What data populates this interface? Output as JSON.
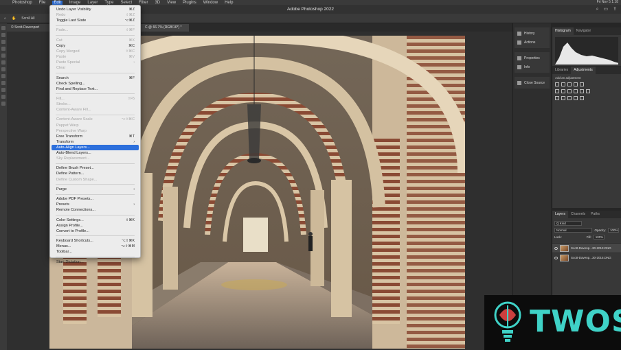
{
  "menubar": {
    "app": "Photoshop",
    "items": [
      "File",
      "Edit",
      "Image",
      "Layer",
      "Type",
      "Select",
      "Filter",
      "3D",
      "View",
      "Plugins",
      "Window",
      "Help"
    ],
    "clock": "Fri Nov 5  1:18"
  },
  "window": {
    "title": "Adobe Photoshop 2022"
  },
  "tabs": [
    {
      "label": "© Scott-Davenport"
    },
    {
      "label": "C @ 66.7% (RGB/16*) *"
    }
  ],
  "optbar": {
    "label": "Scroll All"
  },
  "edit_menu": {
    "groups": [
      [
        {
          "label": "Undo Layer Visibility",
          "shortcut": "⌘Z",
          "enabled": true
        },
        {
          "label": "Redo",
          "shortcut": "⇧⌘Z",
          "enabled": false
        },
        {
          "label": "Toggle Last State",
          "shortcut": "⌥⌘Z",
          "enabled": true
        }
      ],
      [
        {
          "label": "Fade...",
          "shortcut": "⇧⌘F",
          "enabled": false
        }
      ],
      [
        {
          "label": "Cut",
          "shortcut": "⌘X",
          "enabled": false
        },
        {
          "label": "Copy",
          "shortcut": "⌘C",
          "enabled": true
        },
        {
          "label": "Copy Merged",
          "shortcut": "⇧⌘C",
          "enabled": false
        },
        {
          "label": "Paste",
          "shortcut": "⌘V",
          "enabled": false
        },
        {
          "label": "Paste Special",
          "submenu": true,
          "enabled": false
        },
        {
          "label": "Clear",
          "enabled": false
        }
      ],
      [
        {
          "label": "Search",
          "shortcut": "⌘F",
          "enabled": true
        },
        {
          "label": "Check Spelling...",
          "enabled": true
        },
        {
          "label": "Find and Replace Text...",
          "enabled": true
        }
      ],
      [
        {
          "label": "Fill...",
          "shortcut": "⇧F5",
          "enabled": false
        },
        {
          "label": "Stroke...",
          "enabled": false
        },
        {
          "label": "Content-Aware Fill...",
          "enabled": false
        }
      ],
      [
        {
          "label": "Content-Aware Scale",
          "shortcut": "⌥⇧⌘C",
          "enabled": false
        },
        {
          "label": "Puppet Warp",
          "enabled": false
        },
        {
          "label": "Perspective Warp",
          "enabled": false
        },
        {
          "label": "Free Transform",
          "shortcut": "⌘T",
          "enabled": true
        },
        {
          "label": "Transform",
          "submenu": true,
          "enabled": true
        },
        {
          "label": "Auto-Align Layers...",
          "enabled": true,
          "highlighted": true
        },
        {
          "label": "Auto-Blend Layers...",
          "enabled": true
        },
        {
          "label": "Sky Replacement...",
          "enabled": false
        }
      ],
      [
        {
          "label": "Define Brush Preset...",
          "enabled": true
        },
        {
          "label": "Define Pattern...",
          "enabled": true
        },
        {
          "label": "Define Custom Shape...",
          "enabled": false
        }
      ],
      [
        {
          "label": "Purge",
          "submenu": true,
          "enabled": true
        }
      ],
      [
        {
          "label": "Adobe PDF Presets...",
          "enabled": true
        },
        {
          "label": "Presets",
          "submenu": true,
          "enabled": true
        },
        {
          "label": "Remote Connections...",
          "enabled": true
        }
      ],
      [
        {
          "label": "Color Settings...",
          "shortcut": "⇧⌘K",
          "enabled": true
        },
        {
          "label": "Assign Profile...",
          "enabled": true
        },
        {
          "label": "Convert to Profile...",
          "enabled": true
        }
      ],
      [
        {
          "label": "Keyboard Shortcuts...",
          "shortcut": "⌥⇧⌘K",
          "enabled": true
        },
        {
          "label": "Menus...",
          "shortcut": "⌥⇧⌘M",
          "enabled": true
        },
        {
          "label": "Toolbar...",
          "enabled": true
        }
      ],
      [
        {
          "label": "Start Dictation...",
          "enabled": true
        }
      ]
    ]
  },
  "icon_column": {
    "group1": [
      {
        "label": "History",
        "icon": "history-icon"
      },
      {
        "label": "Actions",
        "icon": "play-icon"
      }
    ],
    "group2": [
      {
        "label": "Properties",
        "icon": "sliders-icon"
      },
      {
        "label": "Info",
        "icon": "info-icon"
      }
    ],
    "group3": [
      {
        "label": "Close Source",
        "icon": "clone-source-icon"
      }
    ]
  },
  "histogram_panel": {
    "tabs": [
      "Histogram",
      "Navigator"
    ]
  },
  "adjustments_panel": {
    "tabs": [
      "Libraries",
      "Adjustments"
    ],
    "hint": "Add an adjustment"
  },
  "layers_panel": {
    "tabs": [
      "Layers",
      "Channels",
      "Paths"
    ],
    "filter": "Q Kind",
    "blend_mode": "Normal",
    "opacity_label": "Opacity:",
    "opacity": "100%",
    "lock_label": "Lock:",
    "fill_label": "Fill:",
    "fill": "100%",
    "layers": [
      {
        "name": "Scott-Davenp...30-2013.DNG"
      },
      {
        "name": "Scott-Davenp...30-2015.DNG"
      }
    ]
  },
  "watermark": {
    "text": "TWOS"
  }
}
